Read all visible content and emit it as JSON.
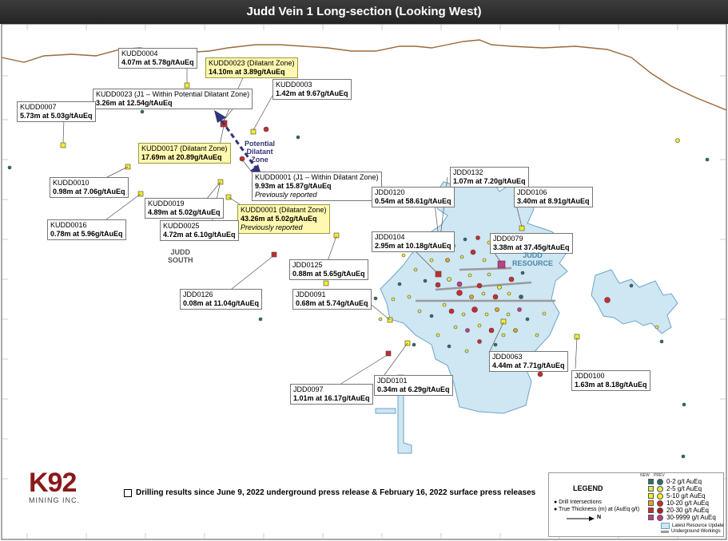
{
  "title": "Judd Vein 1 Long-section (Looking West)",
  "callouts": [
    {
      "id": "kudd0004",
      "hole": "KUDD0004",
      "result": "4.07m at 5.78g/tAuEq",
      "style": "white"
    },
    {
      "id": "kudd0023dz",
      "hole": "KUDD0023 (Dilatant Zone)",
      "result": "14.10m at 3.89g/tAuEq",
      "style": "yellow"
    },
    {
      "id": "kudd0003",
      "hole": "KUDD0003",
      "result": "1.42m at 9.67g/tAuEq",
      "style": "white"
    },
    {
      "id": "kudd0023j1",
      "hole": "KUDD0023 (J1 – Within Potential Dilatant Zone)",
      "result": "3.26m at 12.54g/tAuEq",
      "style": "white"
    },
    {
      "id": "kudd0007",
      "hole": "KUDD0007",
      "result": "5.73m at 5.03g/tAuEq",
      "style": "white"
    },
    {
      "id": "kudd0017",
      "hole": "KUDD0017 (Dilatant Zone)",
      "result": "17.69m at 20.89g/tAuEq",
      "style": "yellow"
    },
    {
      "id": "kudd0001j1",
      "hole": "KUDD0001 (J1 – Within Dilatant Zone)",
      "result": "9.93m at 15.87g/tAuEq",
      "note": "Previously reported",
      "style": "white"
    },
    {
      "id": "kudd0010",
      "hole": "KUDD0010",
      "result": "0.98m at 7.06g/tAuEq",
      "style": "white"
    },
    {
      "id": "kudd0019",
      "hole": "KUDD0019",
      "result": "4.89m at 5.02g/tAuEq",
      "style": "white"
    },
    {
      "id": "kudd0001dz",
      "hole": "KUDD0001 (Dilatant Zone)",
      "result": "43.26m at 5.02g/tAuEq",
      "note": "Previously reported",
      "style": "yellow"
    },
    {
      "id": "kudd0016",
      "hole": "KUDD0016",
      "result": "0.78m at 5.96g/tAuEq",
      "style": "white"
    },
    {
      "id": "kudd0025",
      "hole": "KUDD0025",
      "result": "4.72m at 6.10g/tAuEq",
      "style": "white"
    },
    {
      "id": "jdd0132",
      "hole": "JDD0132",
      "result": "1.07m at 7.20g/tAuEq",
      "style": "white"
    },
    {
      "id": "jdd0120",
      "hole": "JDD0120",
      "result": "0.54m at 58.61g/tAuEq",
      "style": "white"
    },
    {
      "id": "jdd0106",
      "hole": "JDD0106",
      "result": "3.40m at 8.91g/tAuEq",
      "style": "white"
    },
    {
      "id": "jdd0104",
      "hole": "JDD0104",
      "result": "2.95m at 10.18g/tAuEq",
      "style": "white"
    },
    {
      "id": "jdd0079",
      "hole": "JDD0079",
      "result": "3.38m at 37.45g/tAuEq",
      "style": "white"
    },
    {
      "id": "jdd0125",
      "hole": "JDD0125",
      "result": "0.88m at 5.65g/tAuEq",
      "style": "white"
    },
    {
      "id": "jdd0126",
      "hole": "JDD0126",
      "result": "0.08m at 11.04g/tAuEq",
      "style": "white"
    },
    {
      "id": "jdd0091",
      "hole": "JDD0091",
      "result": "0.68m at 5.74g/tAuEq",
      "style": "white"
    },
    {
      "id": "jdd0063",
      "hole": "JDD0063",
      "result": "4.44m at 7.71g/tAuEq",
      "style": "white"
    },
    {
      "id": "jdd0100",
      "hole": "JDD0100",
      "result": "1.63m at 8.18g/tAuEq",
      "style": "white"
    },
    {
      "id": "jdd0097",
      "hole": "JDD0097",
      "result": "1.01m at 16.17g/tAuEq",
      "style": "white"
    },
    {
      "id": "jdd0101",
      "hole": "JDD0101",
      "result": "0.34m at 6.29g/tAuEq",
      "style": "white"
    }
  ],
  "labels": {
    "potential_zone": [
      "Potential",
      "Dilatant",
      "Zone"
    ],
    "judd_south": [
      "JUDD",
      "SOUTH"
    ],
    "judd_resource": [
      "JUDD",
      "RESOURCE"
    ]
  },
  "banner": "Drilling results since June 9, 2022 underground press release & February 16, 2022 surface press releases",
  "logo": {
    "name": "K92",
    "sub": "MINING INC."
  },
  "legend": {
    "title": "LEGEND",
    "col_new": "NEW",
    "col_prev": "PREV",
    "notes": [
      "Drill Intersections",
      "True Thickness (m) at (AuEq g/t)"
    ],
    "north": "N",
    "grades": [
      {
        "label": "0-2 g/t AuEq",
        "color": "#2b6e6e"
      },
      {
        "label": "2-5 g/t AuEq",
        "color": "#d8e85a"
      },
      {
        "label": "5-10 g/t AuEq",
        "color": "#f2ee2a"
      },
      {
        "label": "10-20 g/t AuEq",
        "color": "#e2a51c"
      },
      {
        "label": "20-30 g/t AuEq",
        "color": "#cc2a2a"
      },
      {
        "label": "30-9999 g/t AuEq",
        "color": "#c03d8a"
      }
    ],
    "resource": "Latest Resource Update",
    "workings": "Underground Workings"
  },
  "colors": {
    "topography": "#9a6a3a",
    "resource_fill": "#cfe6f3",
    "resource_stroke": "#6aa6c8",
    "workings": "#9a9a9a",
    "arrow": "#33337a",
    "yellow_box": "#fff8b0"
  }
}
